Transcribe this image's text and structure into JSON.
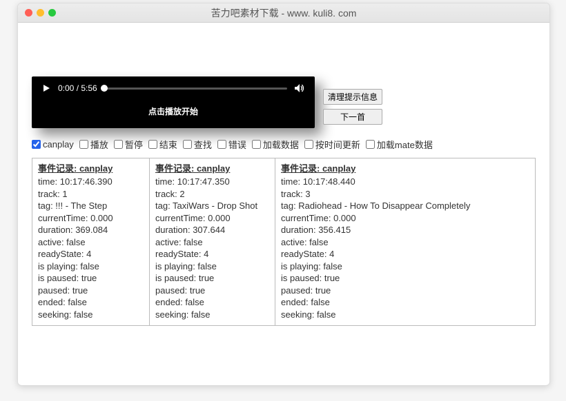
{
  "window": {
    "title": "苦力吧素材下载 - www. kuli8. com"
  },
  "player": {
    "time_display": "0:00 / 5:56",
    "caption": "点击播放开始"
  },
  "side_buttons": {
    "clear": "清理提示信息",
    "next": "下一首"
  },
  "checks": [
    {
      "label": "canplay",
      "checked": true
    },
    {
      "label": "播放",
      "checked": false
    },
    {
      "label": "暂停",
      "checked": false
    },
    {
      "label": "结束",
      "checked": false
    },
    {
      "label": "查找",
      "checked": false
    },
    {
      "label": "错误",
      "checked": false
    },
    {
      "label": "加载数据",
      "checked": false
    },
    {
      "label": "按时间更新",
      "checked": false
    },
    {
      "label": "加载mate数据",
      "checked": false
    }
  ],
  "log_header_prefix": "事件记录: ",
  "log_cols": [
    {
      "event": "canplay",
      "lines": [
        "time: 10:17:46.390",
        "track: 1",
        "tag: !!! - The Step",
        "currentTime: 0.000",
        "duration: 369.084",
        "active: false",
        "readyState: 4",
        "is playing: false",
        "is paused: true",
        "paused: true",
        "ended: false",
        "seeking: false"
      ]
    },
    {
      "event": "canplay",
      "lines": [
        "time: 10:17:47.350",
        "track: 2",
        "tag: TaxiWars - Drop Shot",
        "currentTime: 0.000",
        "duration: 307.644",
        "active: false",
        "readyState: 4",
        "is playing: false",
        "is paused: true",
        "paused: true",
        "ended: false",
        "seeking: false"
      ]
    },
    {
      "event": "canplay",
      "lines": [
        "time: 10:17:48.440",
        "track: 3",
        "tag: Radiohead - How To Disappear Completely",
        "currentTime: 0.000",
        "duration: 356.415",
        "active: false",
        "readyState: 4",
        "is playing: false",
        "is paused: true",
        "paused: true",
        "ended: false",
        "seeking: false"
      ]
    }
  ]
}
